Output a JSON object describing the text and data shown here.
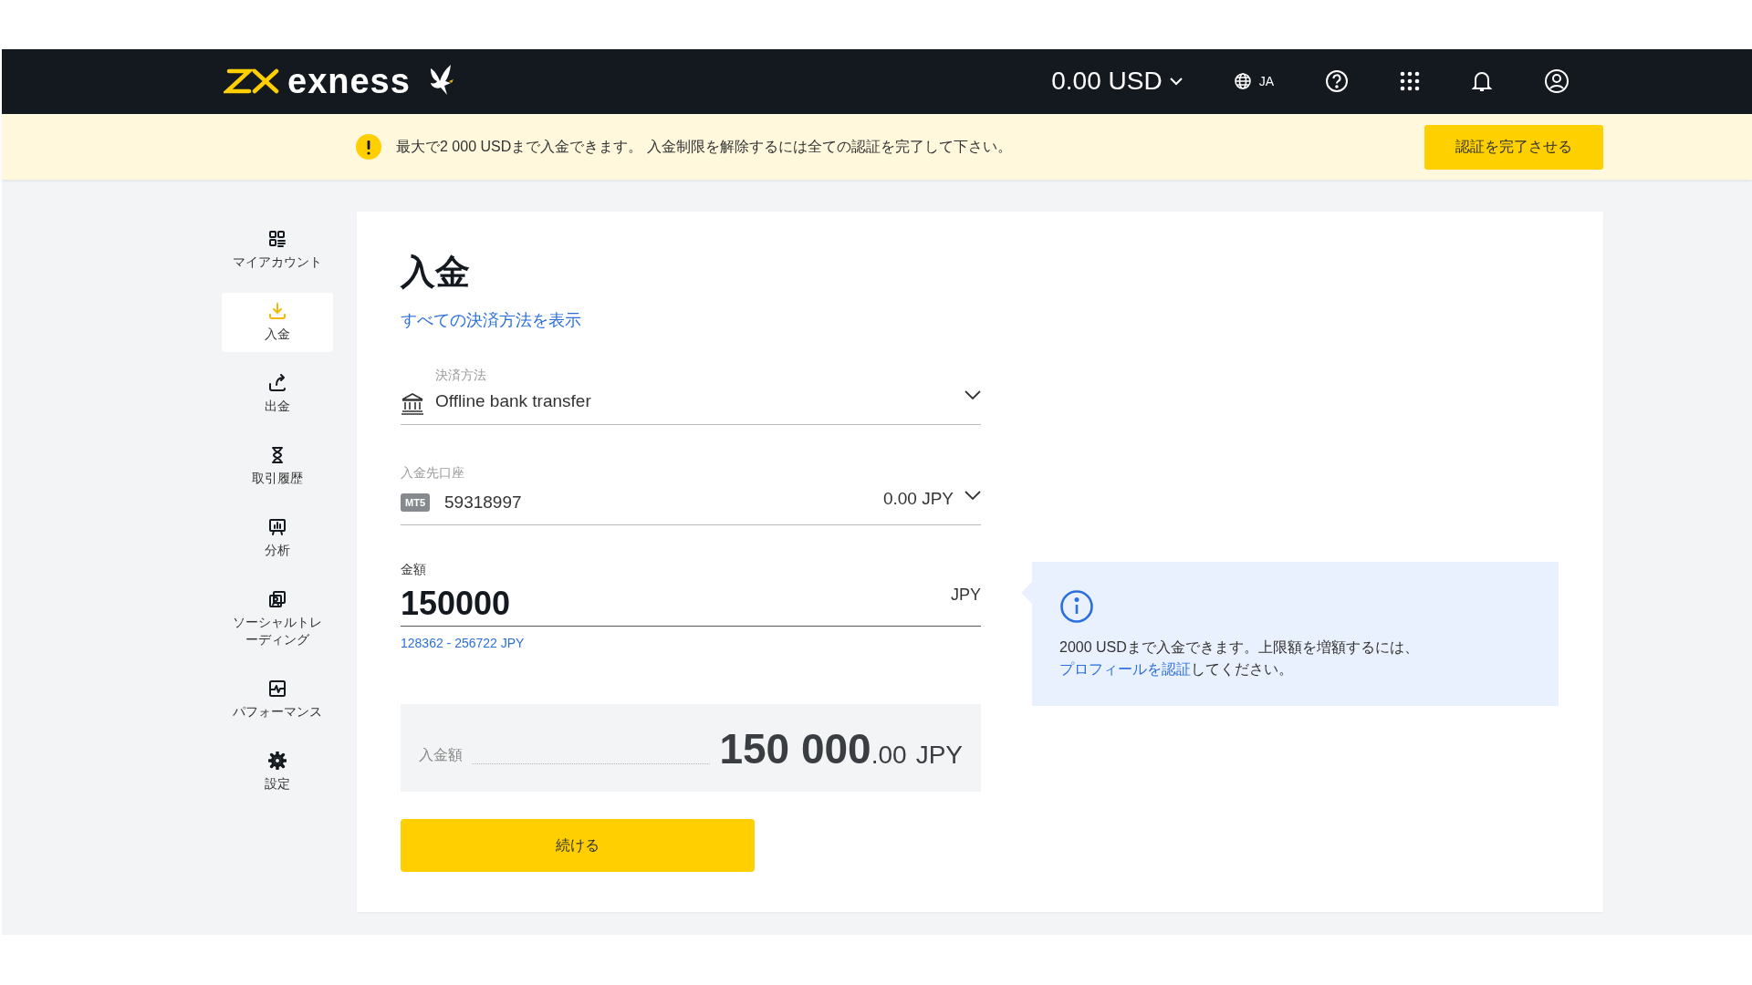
{
  "header": {
    "logo_text": "exness",
    "balance": "0.00 USD",
    "language": "JA"
  },
  "banner": {
    "message": "最大で2 000 USDまで入金できます。 入金制限を解除するには全ての認証を完了して下さい。",
    "button": "認証を完了させる"
  },
  "sidebar": {
    "items": [
      {
        "kind": "account",
        "label": "マイアカウント",
        "selected": false
      },
      {
        "kind": "deposit",
        "label": "入金",
        "selected": true
      },
      {
        "kind": "withdraw",
        "label": "出金",
        "selected": false
      },
      {
        "kind": "history",
        "label": "取引履歴",
        "selected": false
      },
      {
        "kind": "analysis",
        "label": "分析",
        "selected": false
      },
      {
        "kind": "social",
        "label": "ソーシャルトレーディング",
        "selected": false
      },
      {
        "kind": "performance",
        "label": "パフォーマンス",
        "selected": false
      },
      {
        "kind": "settings",
        "label": "設定",
        "selected": false
      }
    ]
  },
  "page": {
    "title": "入金",
    "all_methods_link": "すべての決済方法を表示",
    "payment_method": {
      "label": "決済方法",
      "value": "Offline bank transfer"
    },
    "account": {
      "label": "入金先口座",
      "badge": "MT5",
      "number": "59318997",
      "balance": "0.00 JPY"
    },
    "amount": {
      "label": "金額",
      "value": "150000",
      "currency": "JPY",
      "range": "128362 - 256722 JPY"
    },
    "summary": {
      "label": "入金額",
      "amount_int": "150 000",
      "amount_dec": ".00",
      "currency": "JPY"
    },
    "continue_button": "続ける"
  },
  "info": {
    "text": "2000 USDまで入金できます。上限額を増額するには、",
    "link": "プロフィールを認証",
    "text_after": "してください。"
  }
}
